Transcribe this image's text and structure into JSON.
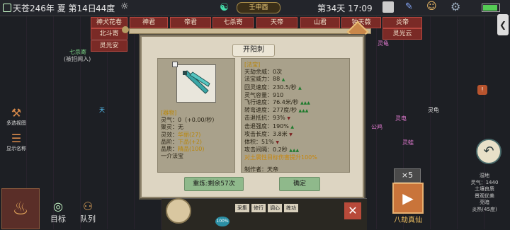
{
  "topbar": {
    "date": "天苍246年 夏 第14日",
    "temperature": "44度",
    "location": "壬申酉",
    "time": "第34天 17:09"
  },
  "map_tags": [
    "神犬花卷",
    "神君",
    "帝君",
    "七杀寄",
    "天帝",
    "山君",
    "钟天薇",
    "炎帝",
    "北斗寄",
    "灵光安",
    "灵光云"
  ],
  "npcs": {
    "qisha": "七杀寄",
    "qisha_sub": "(被招闻入)",
    "sky": "天",
    "linggui": "灵龟",
    "gongji": "公鸡",
    "lingdian": "灵电",
    "lingwa": "灵蛙",
    "linggui2": "灵龟"
  },
  "left_actions": {
    "a1": "多选视图",
    "a2": "显示名称"
  },
  "dialog": {
    "title": "开阳刺",
    "left_stats": [
      {
        "label": "[器物]",
        "value": ""
      },
      {
        "label": "灵气",
        "value": "0（+0.00/秒）"
      },
      {
        "label": "聚灵",
        "value": "无"
      },
      {
        "label": "灵效",
        "value": "华丽(27)"
      },
      {
        "label": "品阶",
        "value": "下品(+2)"
      },
      {
        "label": "品质",
        "value": "精品(100)"
      },
      {
        "label": "一介法宝",
        "value": ""
      }
    ],
    "right_stats": [
      {
        "label": "[法宝]",
        "value": ""
      },
      {
        "label": "天劫余威",
        "value": "0次"
      },
      {
        "label": "法宝威力",
        "value": "88"
      },
      {
        "label": "回灵速度",
        "value": "230.5/秒"
      },
      {
        "label": "灵气容量",
        "value": "910"
      },
      {
        "label": "飞行速度",
        "value": "76.4米/秒"
      },
      {
        "label": "转弯速度",
        "value": "277度/秒"
      },
      {
        "label": "击退抵抗",
        "value": "93%"
      },
      {
        "label": "击退强度",
        "value": "190%"
      },
      {
        "label": "攻击长度",
        "value": "3.8米"
      },
      {
        "label": "体积",
        "value": "51%"
      },
      {
        "label": "攻击间隔",
        "value": "0.2秒"
      },
      {
        "label": "对土属性目标伤害提升",
        "value": "100%"
      }
    ],
    "maker_label": "制作者：",
    "maker": "天帝",
    "refine_button": "重炼:剩余57次",
    "confirm_button": "确定"
  },
  "bottom": {
    "target": "目标",
    "squad": "队列",
    "tabs": [
      "采集",
      "修行",
      "调心",
      "练功"
    ],
    "percent": "100%",
    "multiplier": "×5",
    "eight_kalpa": "八劫真仙"
  },
  "terrain": {
    "name": "湿地",
    "lingqi": "灵气：1440",
    "soil": "土壤良质",
    "view": "景观优美",
    "brightness": "亮暗",
    "heat": "炎热(45度)"
  },
  "colors": {
    "dialog_bg": "#ddd5c2",
    "button": "#8fb98b",
    "gold_text": "#b8860b",
    "green_icon": "#1d7a2c"
  }
}
